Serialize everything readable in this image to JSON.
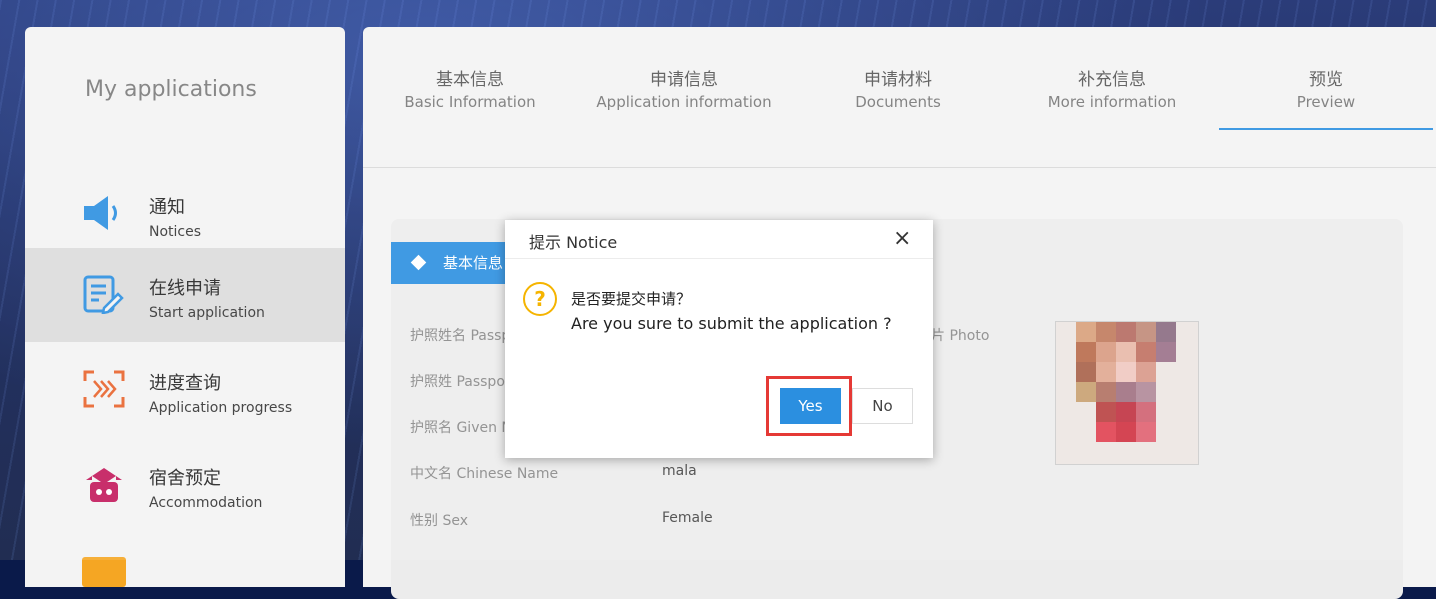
{
  "colors": {
    "accent": "#2b8fe0",
    "warning": "#f5b400",
    "highlight": "#e53935"
  },
  "sidebar": {
    "title": "My applications",
    "items": [
      {
        "zh": "通知",
        "en": "Notices",
        "icon": "speaker-icon"
      },
      {
        "zh": "在线申请",
        "en": "Start application",
        "icon": "edit-form-icon",
        "active": true
      },
      {
        "zh": "进度查询",
        "en": "Application progress",
        "icon": "progress-scan-icon"
      },
      {
        "zh": "宿舍预定",
        "en": "Accommodation",
        "icon": "dormitory-icon"
      }
    ]
  },
  "tabs": [
    {
      "zh": "基本信息",
      "en": "Basic Information"
    },
    {
      "zh": "申请信息",
      "en": "Application information"
    },
    {
      "zh": "申请材料",
      "en": "Documents"
    },
    {
      "zh": "补充信息",
      "en": "More information"
    },
    {
      "zh": "预览",
      "en": "Preview",
      "active": true
    }
  ],
  "section": {
    "title": "基本信息"
  },
  "fields": {
    "passport_full": {
      "label": "护照姓名 Passp"
    },
    "passport_surname": {
      "label": "护照姓 Passpo"
    },
    "given_name": {
      "label": "护照名 Given N"
    },
    "chinese_name": {
      "label": "中文名 Chinese Name",
      "value": "mala"
    },
    "sex": {
      "label": "性别 Sex",
      "value": "Female"
    },
    "photo_label": "片 Photo"
  },
  "dialog": {
    "title": "提示 Notice",
    "close": "×",
    "icon_glyph": "?",
    "message_zh": "是否要提交申请？",
    "message_en": "Are you sure to submit the application ?",
    "yes": "Yes",
    "no": "No"
  }
}
